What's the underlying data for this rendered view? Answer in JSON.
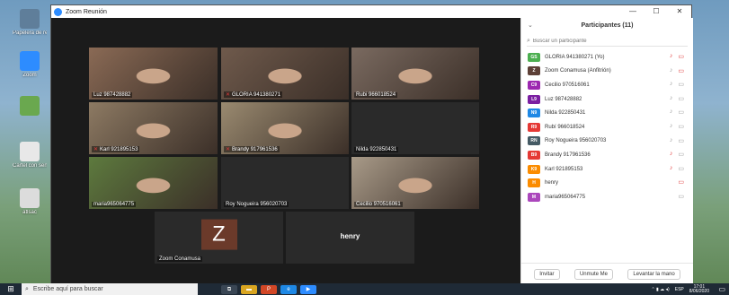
{
  "desktop": {
    "icons": [
      {
        "label": "Papelera de reciclaje",
        "color": "#5f7e9a"
      },
      {
        "label": "Zoom",
        "color": "#2d8cff"
      },
      {
        "label": "",
        "color": "#6aa84f"
      },
      {
        "label": "Cartel con sentilabar",
        "color": "#e8e8e8"
      },
      {
        "label": "atlsac",
        "color": "#dcdcdc"
      }
    ]
  },
  "window": {
    "title": "Zoom Reunión",
    "controls": {
      "minimize": "—",
      "maximize": "☐",
      "close": "✕"
    }
  },
  "tiles": [
    {
      "name": "Luz 987428882",
      "muted": false,
      "active": true,
      "kind": "video",
      "bg": "#8a6a55"
    },
    {
      "name": "GLORIA 941380271",
      "muted": true,
      "active": false,
      "kind": "video",
      "bg": "#6f5a4c"
    },
    {
      "name": "Rubi 966018524",
      "muted": false,
      "active": false,
      "kind": "video",
      "bg": "#7a6a60"
    },
    {
      "name": "Karl 921895153",
      "muted": true,
      "active": false,
      "kind": "video",
      "bg": "#8d7a63"
    },
    {
      "name": "Brandy 917961536",
      "muted": true,
      "active": false,
      "kind": "video",
      "bg": "#9a8a70"
    },
    {
      "name": "Nilda 922850431",
      "muted": false,
      "active": false,
      "kind": "dark",
      "bg": "#2a2a2a"
    },
    {
      "name": "maria965064775",
      "muted": false,
      "active": false,
      "kind": "video",
      "bg": "#5d7a3e"
    },
    {
      "name": "Roy Nogueira 956020703",
      "muted": false,
      "active": false,
      "kind": "dark",
      "bg": "#2a2a2a"
    },
    {
      "name": "Cecilio 970516061",
      "muted": false,
      "active": false,
      "kind": "video",
      "bg": "#a89a88"
    },
    {
      "name": "Zoom Conamusa",
      "muted": false,
      "active": false,
      "kind": "avatar",
      "letter": "Z",
      "bg": "#2a2a2a"
    },
    {
      "name": "henry",
      "muted": false,
      "active": false,
      "kind": "nameonly",
      "bg": "#2a2a2a"
    }
  ],
  "panel": {
    "title": "Participantes (11)",
    "chevron": "⌄",
    "search_placeholder": "Buscar un participante",
    "participants": [
      {
        "initials": "GS",
        "color": "#4caf50",
        "name": "GLORIA 941380271 (Yo)",
        "mic_off": true,
        "cam_off": true
      },
      {
        "initials": "Z",
        "color": "#5d4037",
        "name": "Zoom Conamusa (Anfitrión)",
        "mic_off": false,
        "cam_off": true
      },
      {
        "initials": "C9",
        "color": "#9c27b0",
        "name": "Cecilio 970516061",
        "mic_off": false,
        "cam_off": false
      },
      {
        "initials": "L9",
        "color": "#7b1fa2",
        "name": "Luz 987428882",
        "mic_off": false,
        "cam_off": false
      },
      {
        "initials": "N9",
        "color": "#1e88e5",
        "name": "Nilda 922850431",
        "mic_off": false,
        "cam_off": false
      },
      {
        "initials": "R9",
        "color": "#e53935",
        "name": "Rubí 966018524",
        "mic_off": false,
        "cam_off": false
      },
      {
        "initials": "RN",
        "color": "#455a64",
        "name": "Roy Nogueira 956020703",
        "mic_off": false,
        "cam_off": false
      },
      {
        "initials": "B9",
        "color": "#e53935",
        "name": "Brandy 917961536",
        "mic_off": true,
        "cam_off": false
      },
      {
        "initials": "K9",
        "color": "#fb8c00",
        "name": "Karl 921895153",
        "mic_off": true,
        "cam_off": false
      },
      {
        "initials": "H",
        "color": "#fb8c00",
        "name": "henry",
        "mic_off": false,
        "cam_off": true,
        "no_mic": true
      },
      {
        "initials": "M",
        "color": "#ab47bc",
        "name": "maria965064775",
        "mic_off": false,
        "cam_off": false,
        "no_mic": true
      }
    ],
    "footer": {
      "invite": "Invitar",
      "unmute": "Unmute Me",
      "raise_hand": "Levantar la mano"
    }
  },
  "taskbar": {
    "start": "⊞",
    "search_text": "Escribe aquí para buscar",
    "lang": "ESP",
    "time": "17:01",
    "date": "8/06/2020",
    "notification": "▭"
  }
}
